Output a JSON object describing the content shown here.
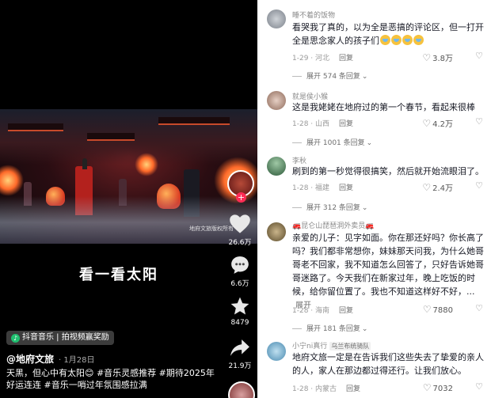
{
  "video": {
    "subtitle": "看一看太阳",
    "watermark": "地府文旅版权所有",
    "actions": {
      "like_count": "26.6万",
      "comment_count": "6.6万",
      "favorite_count": "8479",
      "share_count": "21.9万"
    },
    "music_badge": "抖音音乐 | 拍视频赢奖励",
    "author": "@地府文旅",
    "date": "· 1月28日",
    "caption": "天黑，但心中有太阳😊 #音乐灵感推荐 #期待2025年好运连连 #音乐一哨过年氛围感拉满"
  },
  "comments": [
    {
      "username": "睡不着的饭物",
      "text_before_emoji": "看哭我了真的，以为全是恶搞的评论区，但一打开全是思念家人的孩子们",
      "emoji_count_label": "😭😭😭😭",
      "meta_time": "1-29 · 河北",
      "reply_label": "回复",
      "likes": "3.8万",
      "expand": "展开 574 条回复"
    },
    {
      "username": "就是侯小猴",
      "text": "这是我姥姥在地府过的第一个春节，看起来很棒",
      "meta_time": "1-28 · 山西",
      "reply_label": "回复",
      "likes": "4.2万",
      "expand": "展开 1001 条回复"
    },
    {
      "username": "李秋",
      "text": "刷到的第一秒觉得很搞笑，然后就开始流眼泪了。",
      "meta_time": "1-28 · 福建",
      "reply_label": "回复",
      "likes": "2.4万",
      "expand": "展开 312 条回复"
    },
    {
      "username": "🚒昆仑山琵琶洞外卖员🚒",
      "text": "亲爱的儿子：见字如面。你在那还好吗？你长高了吗？我们都非常想你，妹妹那天问我，为什么她哥哥老不回家，我不知道怎么回答了，只好告诉她哥哥迷路了。今天我们在新家过年，晚上吃饭的时候，给你留位置了。我也不知道这样好不好，...",
      "inline_expand": "展开",
      "meta_time": "1-28 · 海南",
      "reply_label": "回复",
      "likes": "7880",
      "expand": "展开 181 条回复"
    },
    {
      "username": "小宁ni真行",
      "username_badge": "乌兰布统骑队",
      "text": "地府文旅一定是在告诉我们这些失去了挚爱的亲人的人，家人在那边都过得还行。让我们放心。",
      "meta_time": "1-28 · 内蒙古",
      "reply_label": "回复",
      "likes": "7032"
    }
  ],
  "colors": {
    "accent_red": "#fe2c55",
    "text_primary": "#161823",
    "text_secondary": "#8a8a8a"
  }
}
